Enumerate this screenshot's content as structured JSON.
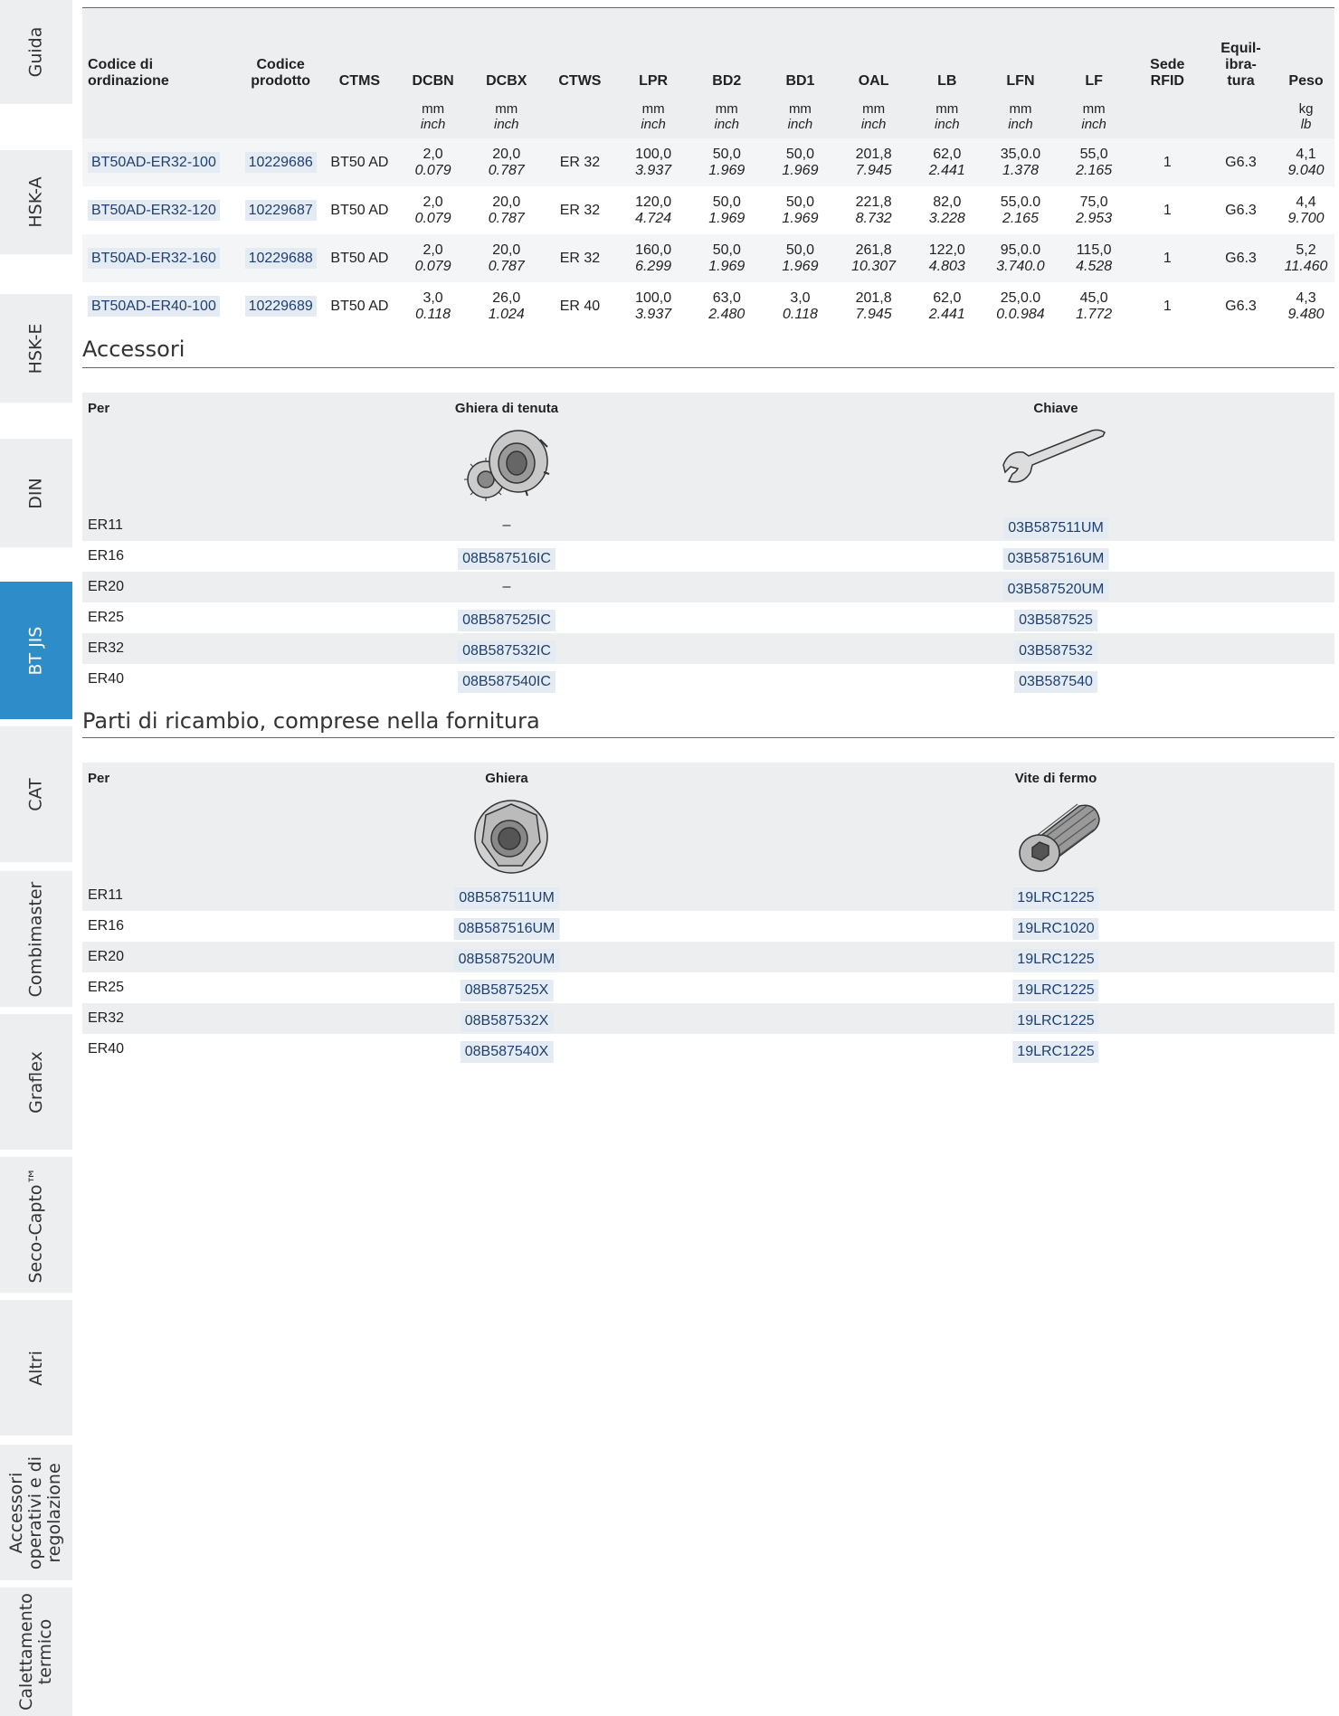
{
  "sidebar": {
    "tabs": [
      {
        "label": "Guida",
        "active": false
      },
      {
        "label": "HSK-A",
        "active": false
      },
      {
        "label": "HSK-E",
        "active": false
      },
      {
        "label": "DIN",
        "active": false
      },
      {
        "label": "BT JIS",
        "active": true
      },
      {
        "label": "CAT",
        "active": false
      },
      {
        "label": "Combimaster",
        "active": false
      },
      {
        "label": "Graflex",
        "active": false
      },
      {
        "label": "Seco-Capto™",
        "active": false
      },
      {
        "label": "Altri",
        "active": false
      },
      {
        "label": "Accessori\noperativi e di\nregolazione",
        "active": false
      },
      {
        "label": "Calettamento\ntermico",
        "active": false
      }
    ],
    "active_color": "#2e8dc8"
  },
  "spec_table": {
    "headers": [
      "Codice di ordinazione",
      "Codice\nprodotto",
      "CTMS",
      "DCBN",
      "DCBX",
      "CTWS",
      "LPR",
      "BD2",
      "BD1",
      "OAL",
      "LB",
      "LFN",
      "LF",
      "Sede\nRFID",
      "Equil-\nibra-\ntura",
      "Peso"
    ],
    "units": [
      {
        "mm": "",
        "inch": ""
      },
      {
        "mm": "",
        "inch": ""
      },
      {
        "mm": "",
        "inch": ""
      },
      {
        "mm": "mm",
        "inch": "inch"
      },
      {
        "mm": "mm",
        "inch": "inch"
      },
      {
        "mm": "",
        "inch": ""
      },
      {
        "mm": "mm",
        "inch": "inch"
      },
      {
        "mm": "mm",
        "inch": "inch"
      },
      {
        "mm": "mm",
        "inch": "inch"
      },
      {
        "mm": "mm",
        "inch": "inch"
      },
      {
        "mm": "mm",
        "inch": "inch"
      },
      {
        "mm": "mm",
        "inch": "inch"
      },
      {
        "mm": "mm",
        "inch": "inch"
      },
      {
        "mm": "",
        "inch": ""
      },
      {
        "mm": "",
        "inch": ""
      },
      {
        "mm": "kg",
        "inch": "lb"
      }
    ],
    "rows": [
      {
        "order_code": "BT50AD-ER32-100",
        "product_code": "10229686",
        "ctms": "BT50 AD",
        "dcbn": [
          "2,0",
          "0.079"
        ],
        "dcbx": [
          "20,0",
          "0.787"
        ],
        "ctws": "ER 32",
        "lpr": [
          "100,0",
          "3.937"
        ],
        "bd2": [
          "50,0",
          "1.969"
        ],
        "bd1": [
          "50,0",
          "1.969"
        ],
        "oal": [
          "201,8",
          "7.945"
        ],
        "lb": [
          "62,0",
          "2.441"
        ],
        "lfn": [
          "35,0.0",
          "1.378"
        ],
        "lf": [
          "55,0",
          "2.165"
        ],
        "rfid": "1",
        "balance": "G6.3",
        "weight": [
          "4,1",
          "9.040"
        ]
      },
      {
        "order_code": "BT50AD-ER32-120",
        "product_code": "10229687",
        "ctms": "BT50 AD",
        "dcbn": [
          "2,0",
          "0.079"
        ],
        "dcbx": [
          "20,0",
          "0.787"
        ],
        "ctws": "ER 32",
        "lpr": [
          "120,0",
          "4.724"
        ],
        "bd2": [
          "50,0",
          "1.969"
        ],
        "bd1": [
          "50,0",
          "1.969"
        ],
        "oal": [
          "221,8",
          "8.732"
        ],
        "lb": [
          "82,0",
          "3.228"
        ],
        "lfn": [
          "55,0.0",
          "2.165"
        ],
        "lf": [
          "75,0",
          "2.953"
        ],
        "rfid": "1",
        "balance": "G6.3",
        "weight": [
          "4,4",
          "9.700"
        ]
      },
      {
        "order_code": "BT50AD-ER32-160",
        "product_code": "10229688",
        "ctms": "BT50 AD",
        "dcbn": [
          "2,0",
          "0.079"
        ],
        "dcbx": [
          "20,0",
          "0.787"
        ],
        "ctws": "ER 32",
        "lpr": [
          "160,0",
          "6.299"
        ],
        "bd2": [
          "50,0",
          "1.969"
        ],
        "bd1": [
          "50,0",
          "1.969"
        ],
        "oal": [
          "261,8",
          "10.307"
        ],
        "lb": [
          "122,0",
          "4.803"
        ],
        "lfn": [
          "95,0.0",
          "3.740.0"
        ],
        "lf": [
          "115,0",
          "4.528"
        ],
        "rfid": "1",
        "balance": "G6.3",
        "weight": [
          "5,2",
          "11.460"
        ]
      },
      {
        "order_code": "BT50AD-ER40-100",
        "product_code": "10229689",
        "ctms": "BT50 AD",
        "dcbn": [
          "3,0",
          "0.118"
        ],
        "dcbx": [
          "26,0",
          "1.024"
        ],
        "ctws": "ER 40",
        "lpr": [
          "100,0",
          "3.937"
        ],
        "bd2": [
          "63,0",
          "2.480"
        ],
        "bd1": [
          "3,0",
          "0.118"
        ],
        "oal": [
          "201,8",
          "7.945"
        ],
        "lb": [
          "62,0",
          "2.441"
        ],
        "lfn": [
          "25,0.0",
          "0.0.984"
        ],
        "lf": [
          "45,0",
          "1.772"
        ],
        "rfid": "1",
        "balance": "G6.3",
        "weight": [
          "4,3",
          "9.480"
        ]
      }
    ]
  },
  "accessori": {
    "title": "Accessori",
    "headers": [
      "Per",
      "Ghiera di tenuta",
      "Chiave"
    ],
    "image_icons": [
      "sealing-nut-icon",
      "wrench-icon"
    ],
    "rows": [
      [
        "ER11",
        "–",
        "03B587511UM"
      ],
      [
        "ER16",
        "08B587516IC",
        "03B587516UM"
      ],
      [
        "ER20",
        "–",
        "03B587520UM"
      ],
      [
        "ER25",
        "08B587525IC",
        "03B587525"
      ],
      [
        "ER32",
        "08B587532IC",
        "03B587532"
      ],
      [
        "ER40",
        "08B587540IC",
        "03B587540"
      ]
    ]
  },
  "ricambi": {
    "title": "Parti di ricambio, comprese nella fornitura",
    "headers": [
      "Per",
      "Ghiera",
      "Vite di fermo"
    ],
    "image_icons": [
      "collet-nut-icon",
      "set-screw-icon"
    ],
    "rows": [
      [
        "ER11",
        "08B587511UM",
        "19LRC1225"
      ],
      [
        "ER16",
        "08B587516UM",
        "19LRC1020"
      ],
      [
        "ER20",
        "08B587520UM",
        "19LRC1225"
      ],
      [
        "ER25",
        "08B587525X",
        "19LRC1225"
      ],
      [
        "ER32",
        "08B587532X",
        "19LRC1225"
      ],
      [
        "ER40",
        "08B587540X",
        "19LRC1225"
      ]
    ]
  }
}
